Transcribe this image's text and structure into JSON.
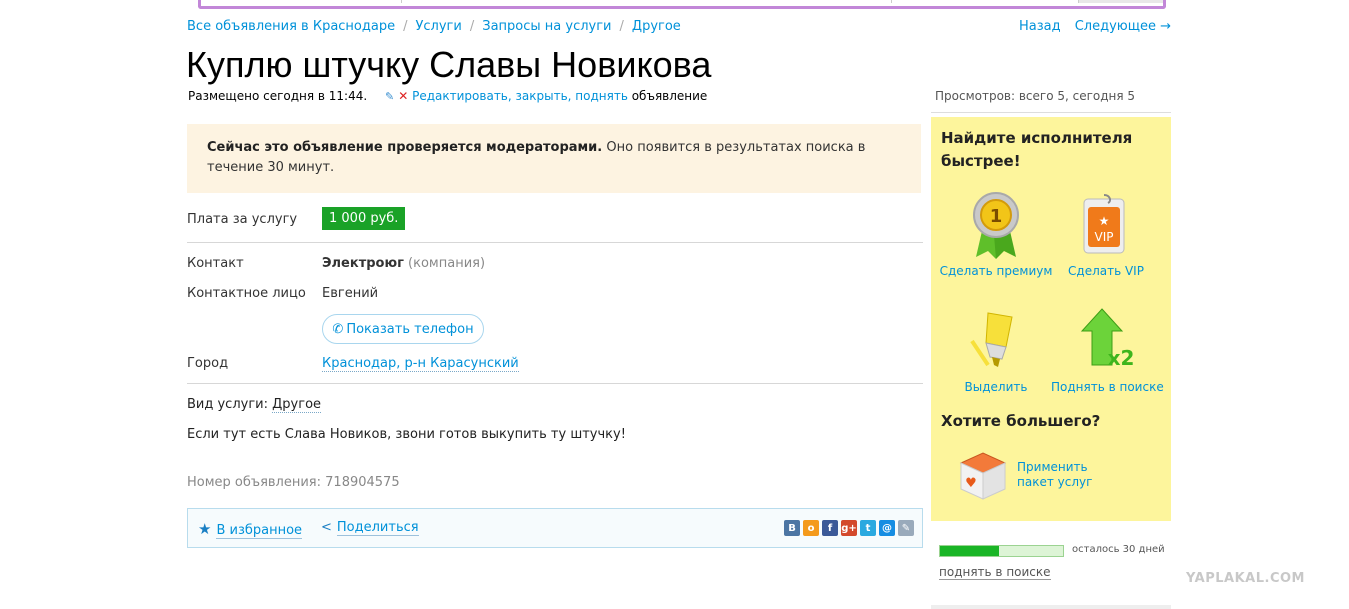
{
  "breadcrumb": {
    "items": [
      "Все объявления в Краснодаре",
      "Услуги",
      "Запросы на услуги",
      "Другое"
    ],
    "separator": "/"
  },
  "nav": {
    "back": "Назад",
    "next": "Следующее →"
  },
  "ad": {
    "title": "Куплю штучку Славы Новикова",
    "posted": "Размещено сегодня в 11:44.",
    "manage_link": "Редактировать, закрыть, поднять",
    "manage_suffix": "объявление",
    "moderation_bold": "Сейчас это объявление проверяется модераторами.",
    "moderation_text": "Оно появится в результатах поиска в течение 30 минут.",
    "price_label": "Плата за услугу",
    "price": "1 000 руб.",
    "contact_label": "Контакт",
    "contact_name": "Электроюг",
    "contact_type": "(компания)",
    "person_label": "Контактное лицо",
    "person": "Евгений",
    "show_phone": "Показать телефон",
    "city_label": "Город",
    "city": "Краснодар, р-н Карасунский",
    "service_label": "Вид услуги:",
    "service": "Другое",
    "description": "Если тут есть Слава Новиков, звони готов выкупить ту штучку!",
    "number_label": "Номер объявления:",
    "number": "718904575",
    "favorites": "В избранное",
    "share": "Поделиться"
  },
  "sidebar": {
    "views": "Просмотров: всего 5, сегодня 5",
    "promo_title": "Найдите исполнителя быстрее!",
    "premium": "Сделать премиум",
    "premium_badge": "1",
    "vip": "Сделать VIP",
    "vip_badge": "VIP",
    "highlight": "Выделить",
    "raise": "Поднять в поиске",
    "raise_badge": "x2",
    "more_title": "Хотите большего?",
    "package": "Применить пакет услуг",
    "remaining": "осталось 30 дней",
    "remaining_fraction": 0.48,
    "raise_link": "поднять в поиске"
  },
  "socials": [
    {
      "icon": "vk-icon",
      "glyph": "B",
      "color": "#4c75a3"
    },
    {
      "icon": "odnoklassniki-icon",
      "glyph": "о",
      "color": "#f49a1c"
    },
    {
      "icon": "facebook-icon",
      "glyph": "f",
      "color": "#3b5998"
    },
    {
      "icon": "google-plus-icon",
      "glyph": "g+",
      "color": "#d3492c"
    },
    {
      "icon": "twitter-icon",
      "glyph": "t",
      "color": "#2aa9e0"
    },
    {
      "icon": "mailru-icon",
      "glyph": "@",
      "color": "#168de2"
    },
    {
      "icon": "livejournal-icon",
      "glyph": "✎",
      "color": "#9ab"
    }
  ],
  "watermark": "YAPLAKAL.COM",
  "colors": {
    "link": "#0091d9",
    "price_bg": "#1aa227",
    "promo_bg": "#fdf59c",
    "moderation_bg": "#fdf3e1"
  }
}
